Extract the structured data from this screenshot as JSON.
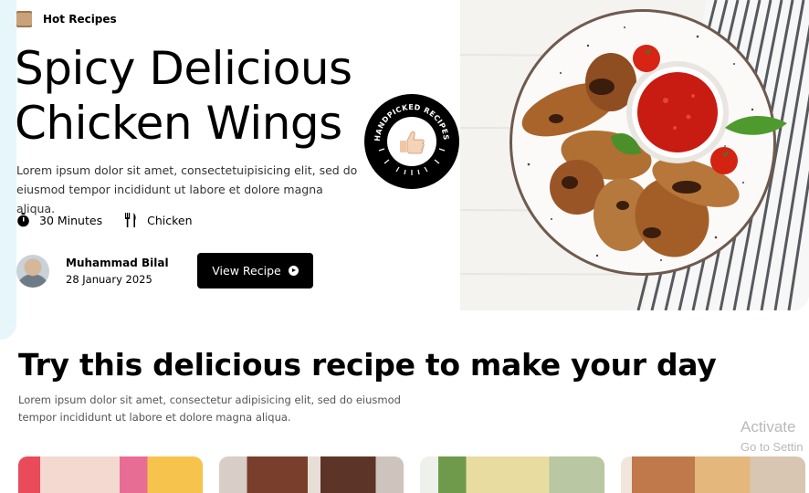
{
  "hero": {
    "label": "Hot Recipes",
    "title_line1": "Spicy Delicious",
    "title_line2": "Chicken Wings",
    "description": "Lorem ipsum dolor sit amet, consectetuipisicing elit, sed do eiusmod tempor incididunt ut labore et dolore magna aliqua.",
    "time": "30 Minutes",
    "category": "Chicken",
    "author_name": "Muhammad Bilal",
    "author_date": "28 January 2025",
    "button_label": "View Recipe",
    "badge_text": "HANDPICKED RECIPES"
  },
  "section": {
    "title": "Try this delicious recipe to make your day",
    "description": "Lorem ipsum dolor sit amet, consectetur adipisicing elit, sed do eiusmod tempor incididunt ut labore et dolore magna aliqua."
  },
  "watermark": {
    "line1": "Activate",
    "line2": "Go to Settin"
  },
  "icons": {
    "label": "scroll-icon",
    "time": "stopwatch-icon",
    "category": "fork-knife-icon",
    "button": "play-icon",
    "badge": "thumbs-up-icon"
  },
  "colors": {
    "accent": "#000000",
    "strip": "#e6f6fb"
  }
}
